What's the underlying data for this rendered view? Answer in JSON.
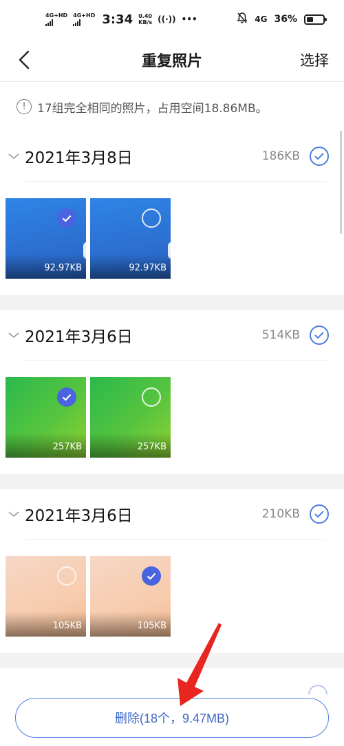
{
  "status_bar": {
    "sim1": "4G+HD",
    "sim2": "4G+HD",
    "time": "3:34",
    "speed_value": "0.40",
    "speed_unit": "KB/s",
    "more": "•••",
    "network": "4G",
    "battery": "36%"
  },
  "nav": {
    "title": "重复照片",
    "select_label": "选择"
  },
  "notice": {
    "text": "17组完全相同的照片，占用空间18.86MB。"
  },
  "groups": [
    {
      "date": "2021年3月8日",
      "size": "186KB",
      "photos": [
        {
          "size": "92.97KB",
          "selected": true,
          "tone": "blue"
        },
        {
          "size": "92.97KB",
          "selected": false,
          "tone": "blue"
        }
      ]
    },
    {
      "date": "2021年3月6日",
      "size": "514KB",
      "photos": [
        {
          "size": "257KB",
          "selected": true,
          "tone": "green"
        },
        {
          "size": "257KB",
          "selected": false,
          "tone": "green"
        }
      ]
    },
    {
      "date": "2021年3月6日",
      "size": "210KB",
      "photos": [
        {
          "size": "105KB",
          "selected": false,
          "tone": "peach"
        },
        {
          "size": "105KB",
          "selected": true,
          "tone": "peach"
        }
      ]
    }
  ],
  "delete_button": {
    "label": "删除(18个，9.47MB)"
  },
  "colors": {
    "accent": "#4a7de0",
    "selected_check": "#4a63e0",
    "annotation_arrow": "#e8251f"
  }
}
